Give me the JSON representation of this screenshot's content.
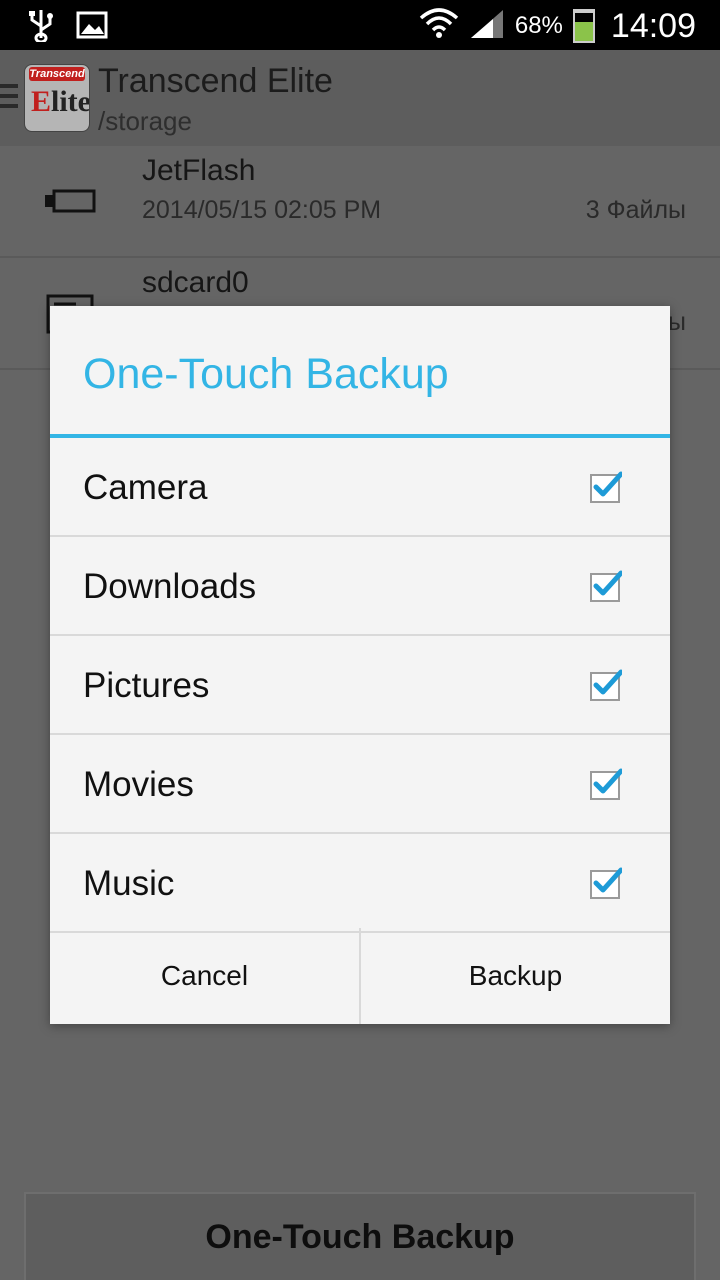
{
  "status_bar": {
    "battery_percent": "68%",
    "battery_level": 0.68,
    "time": "14:09",
    "icons": [
      "usb-icon",
      "gallery-icon",
      "wifi-icon",
      "signal-icon",
      "battery-icon"
    ]
  },
  "app": {
    "title": "Transcend Elite",
    "subtitle": "/storage",
    "logo_brand": "Transcend",
    "logo_e": "E",
    "logo_rest": "lite"
  },
  "list": [
    {
      "name": "JetFlash",
      "date": "2014/05/15 02:05 PM",
      "count": "3 Файлы",
      "icon": "usb-drive-icon"
    },
    {
      "name": "sdcard0",
      "date": "",
      "count": "ы",
      "icon": "sd-card-icon"
    }
  ],
  "dialog": {
    "title": "One-Touch Backup",
    "options": [
      {
        "label": "Camera",
        "checked": true
      },
      {
        "label": "Downloads",
        "checked": true
      },
      {
        "label": "Pictures",
        "checked": true
      },
      {
        "label": "Movies",
        "checked": true
      },
      {
        "label": "Music",
        "checked": true
      }
    ],
    "cancel_label": "Cancel",
    "backup_label": "Backup"
  },
  "bottom_button": {
    "label": "One-Touch Backup"
  },
  "colors": {
    "accent": "#33b5e5",
    "battery": "#8bc34a",
    "logo_red": "#c1201e"
  }
}
